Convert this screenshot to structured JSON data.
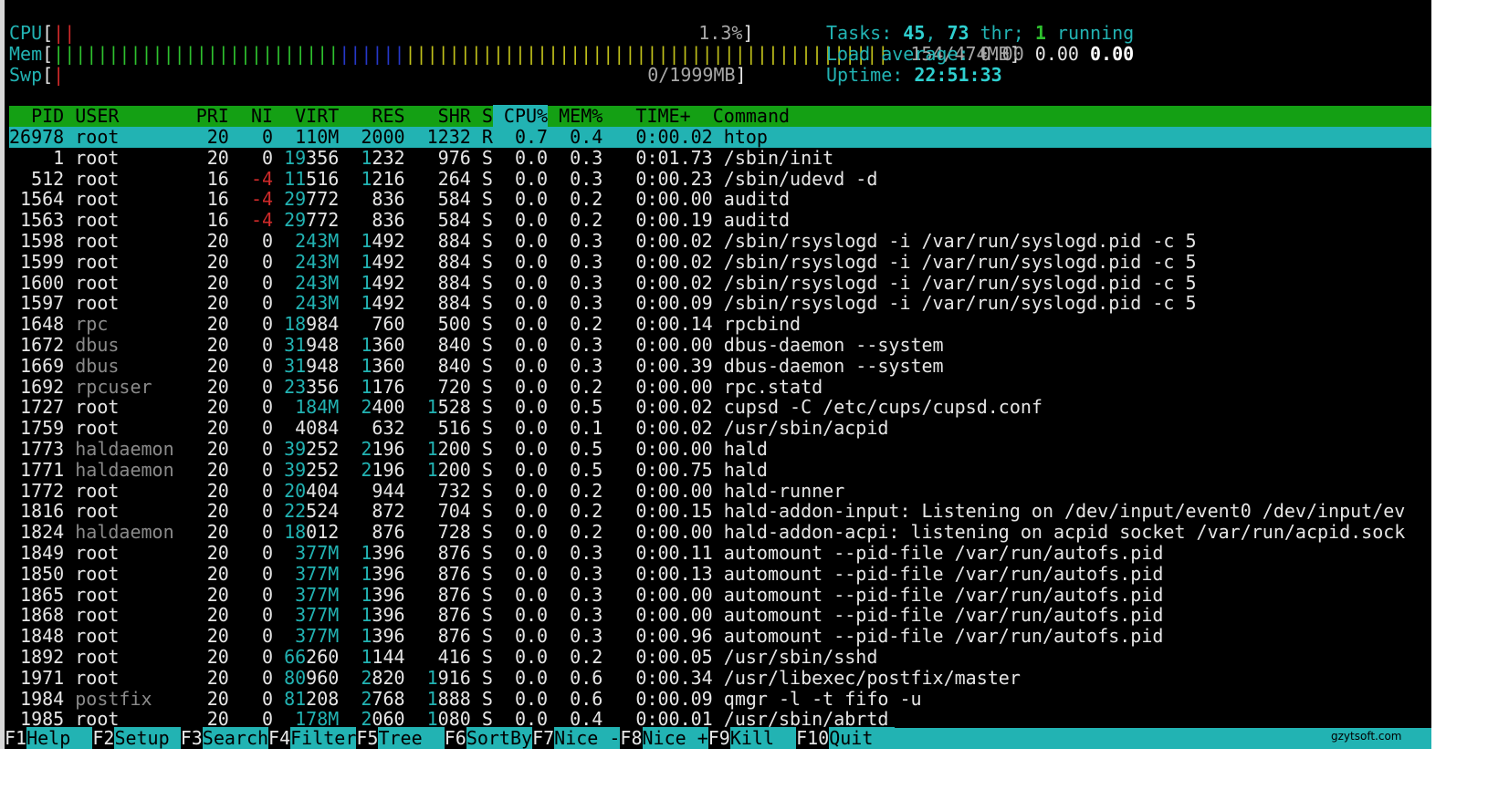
{
  "meters": {
    "cpu": {
      "label": "CPU",
      "value_text": "1.3%",
      "bar": "||"
    },
    "mem": {
      "label": "Mem",
      "value_text": "154/474MB",
      "bar_green": "||||||||||||||||||||||||||",
      "bar_blue": "||||||",
      "bar_yellow": "||||||||||||||||||||||||||||||||||||||||||||"
    },
    "swp": {
      "label": "Swp",
      "value_text": "0/1999MB",
      "bar": "|"
    }
  },
  "summary": {
    "tasks_label": "Tasks: ",
    "tasks": "45",
    "tasks_sep": ", ",
    "threads": "73",
    "thr_label": " thr; ",
    "running": "1",
    "running_label": " running",
    "load_label": "Load average: ",
    "load1": "0.00",
    "load5": "0.00",
    "load15": "0.00",
    "uptime_label": "Uptime: ",
    "uptime": "22:51:33"
  },
  "header": {
    "pid": "  PID",
    "user": " USER     ",
    "pri": "  PRI",
    "ni": "  NI",
    "virt": "  VIRT",
    "res": "   RES",
    "shr": "   SHR",
    "s": " S",
    "cpu": " CPU%",
    "mem": " MEM%",
    "time": "   TIME+  ",
    "cmd": "Command"
  },
  "processes": [
    {
      "pid": "26978",
      "user": "root",
      "pri": "20",
      "ni": "0",
      "virt": "110M",
      "res": "2000",
      "shr": "1232",
      "s": "R",
      "cpu": "0.7",
      "mem": "0.4",
      "time": "0:00.02",
      "cmd": "htop"
    },
    {
      "pid": "1",
      "user": "root",
      "pri": "20",
      "ni": "0",
      "virt": "19356",
      "res": "1232",
      "shr": "976",
      "s": "S",
      "cpu": "0.0",
      "mem": "0.3",
      "time": "0:01.73",
      "cmd": "/sbin/init"
    },
    {
      "pid": "512",
      "user": "root",
      "pri": "16",
      "ni": "-4",
      "virt": "11516",
      "res": "1216",
      "shr": "264",
      "s": "S",
      "cpu": "0.0",
      "mem": "0.3",
      "time": "0:00.23",
      "cmd": "/sbin/udevd -d"
    },
    {
      "pid": "1564",
      "user": "root",
      "pri": "16",
      "ni": "-4",
      "virt": "29772",
      "res": "836",
      "shr": "584",
      "s": "S",
      "cpu": "0.0",
      "mem": "0.2",
      "time": "0:00.00",
      "cmd": "auditd"
    },
    {
      "pid": "1563",
      "user": "root",
      "pri": "16",
      "ni": "-4",
      "virt": "29772",
      "res": "836",
      "shr": "584",
      "s": "S",
      "cpu": "0.0",
      "mem": "0.2",
      "time": "0:00.19",
      "cmd": "auditd"
    },
    {
      "pid": "1598",
      "user": "root",
      "pri": "20",
      "ni": "0",
      "virt": "243M",
      "res": "1492",
      "shr": "884",
      "s": "S",
      "cpu": "0.0",
      "mem": "0.3",
      "time": "0:00.02",
      "cmd": "/sbin/rsyslogd -i /var/run/syslogd.pid -c 5"
    },
    {
      "pid": "1599",
      "user": "root",
      "pri": "20",
      "ni": "0",
      "virt": "243M",
      "res": "1492",
      "shr": "884",
      "s": "S",
      "cpu": "0.0",
      "mem": "0.3",
      "time": "0:00.02",
      "cmd": "/sbin/rsyslogd -i /var/run/syslogd.pid -c 5"
    },
    {
      "pid": "1600",
      "user": "root",
      "pri": "20",
      "ni": "0",
      "virt": "243M",
      "res": "1492",
      "shr": "884",
      "s": "S",
      "cpu": "0.0",
      "mem": "0.3",
      "time": "0:00.02",
      "cmd": "/sbin/rsyslogd -i /var/run/syslogd.pid -c 5"
    },
    {
      "pid": "1597",
      "user": "root",
      "pri": "20",
      "ni": "0",
      "virt": "243M",
      "res": "1492",
      "shr": "884",
      "s": "S",
      "cpu": "0.0",
      "mem": "0.3",
      "time": "0:00.09",
      "cmd": "/sbin/rsyslogd -i /var/run/syslogd.pid -c 5"
    },
    {
      "pid": "1648",
      "user": "rpc",
      "pri": "20",
      "ni": "0",
      "virt": "18984",
      "res": "760",
      "shr": "500",
      "s": "S",
      "cpu": "0.0",
      "mem": "0.2",
      "time": "0:00.14",
      "cmd": "rpcbind"
    },
    {
      "pid": "1672",
      "user": "dbus",
      "pri": "20",
      "ni": "0",
      "virt": "31948",
      "res": "1360",
      "shr": "840",
      "s": "S",
      "cpu": "0.0",
      "mem": "0.3",
      "time": "0:00.00",
      "cmd": "dbus-daemon --system"
    },
    {
      "pid": "1669",
      "user": "dbus",
      "pri": "20",
      "ni": "0",
      "virt": "31948",
      "res": "1360",
      "shr": "840",
      "s": "S",
      "cpu": "0.0",
      "mem": "0.3",
      "time": "0:00.39",
      "cmd": "dbus-daemon --system"
    },
    {
      "pid": "1692",
      "user": "rpcuser",
      "pri": "20",
      "ni": "0",
      "virt": "23356",
      "res": "1176",
      "shr": "720",
      "s": "S",
      "cpu": "0.0",
      "mem": "0.2",
      "time": "0:00.00",
      "cmd": "rpc.statd"
    },
    {
      "pid": "1727",
      "user": "root",
      "pri": "20",
      "ni": "0",
      "virt": "184M",
      "res": "2400",
      "shr": "1528",
      "s": "S",
      "cpu": "0.0",
      "mem": "0.5",
      "time": "0:00.02",
      "cmd": "cupsd -C /etc/cups/cupsd.conf"
    },
    {
      "pid": "1759",
      "user": "root",
      "pri": "20",
      "ni": "0",
      "virt": "4084",
      "res": "632",
      "shr": "516",
      "s": "S",
      "cpu": "0.0",
      "mem": "0.1",
      "time": "0:00.02",
      "cmd": "/usr/sbin/acpid"
    },
    {
      "pid": "1773",
      "user": "haldaemon",
      "pri": "20",
      "ni": "0",
      "virt": "39252",
      "res": "2196",
      "shr": "1200",
      "s": "S",
      "cpu": "0.0",
      "mem": "0.5",
      "time": "0:00.00",
      "cmd": "hald"
    },
    {
      "pid": "1771",
      "user": "haldaemon",
      "pri": "20",
      "ni": "0",
      "virt": "39252",
      "res": "2196",
      "shr": "1200",
      "s": "S",
      "cpu": "0.0",
      "mem": "0.5",
      "time": "0:00.75",
      "cmd": "hald"
    },
    {
      "pid": "1772",
      "user": "root",
      "pri": "20",
      "ni": "0",
      "virt": "20404",
      "res": "944",
      "shr": "732",
      "s": "S",
      "cpu": "0.0",
      "mem": "0.2",
      "time": "0:00.00",
      "cmd": "hald-runner"
    },
    {
      "pid": "1816",
      "user": "root",
      "pri": "20",
      "ni": "0",
      "virt": "22524",
      "res": "872",
      "shr": "704",
      "s": "S",
      "cpu": "0.0",
      "mem": "0.2",
      "time": "0:00.15",
      "cmd": "hald-addon-input: Listening on /dev/input/event0 /dev/input/ev"
    },
    {
      "pid": "1824",
      "user": "haldaemon",
      "pri": "20",
      "ni": "0",
      "virt": "18012",
      "res": "876",
      "shr": "728",
      "s": "S",
      "cpu": "0.0",
      "mem": "0.2",
      "time": "0:00.00",
      "cmd": "hald-addon-acpi: listening on acpid socket /var/run/acpid.sock"
    },
    {
      "pid": "1849",
      "user": "root",
      "pri": "20",
      "ni": "0",
      "virt": "377M",
      "res": "1396",
      "shr": "876",
      "s": "S",
      "cpu": "0.0",
      "mem": "0.3",
      "time": "0:00.11",
      "cmd": "automount --pid-file /var/run/autofs.pid"
    },
    {
      "pid": "1850",
      "user": "root",
      "pri": "20",
      "ni": "0",
      "virt": "377M",
      "res": "1396",
      "shr": "876",
      "s": "S",
      "cpu": "0.0",
      "mem": "0.3",
      "time": "0:00.13",
      "cmd": "automount --pid-file /var/run/autofs.pid"
    },
    {
      "pid": "1865",
      "user": "root",
      "pri": "20",
      "ni": "0",
      "virt": "377M",
      "res": "1396",
      "shr": "876",
      "s": "S",
      "cpu": "0.0",
      "mem": "0.3",
      "time": "0:00.00",
      "cmd": "automount --pid-file /var/run/autofs.pid"
    },
    {
      "pid": "1868",
      "user": "root",
      "pri": "20",
      "ni": "0",
      "virt": "377M",
      "res": "1396",
      "shr": "876",
      "s": "S",
      "cpu": "0.0",
      "mem": "0.3",
      "time": "0:00.00",
      "cmd": "automount --pid-file /var/run/autofs.pid"
    },
    {
      "pid": "1848",
      "user": "root",
      "pri": "20",
      "ni": "0",
      "virt": "377M",
      "res": "1396",
      "shr": "876",
      "s": "S",
      "cpu": "0.0",
      "mem": "0.3",
      "time": "0:00.96",
      "cmd": "automount --pid-file /var/run/autofs.pid"
    },
    {
      "pid": "1892",
      "user": "root",
      "pri": "20",
      "ni": "0",
      "virt": "66260",
      "res": "1144",
      "shr": "416",
      "s": "S",
      "cpu": "0.0",
      "mem": "0.2",
      "time": "0:00.05",
      "cmd": "/usr/sbin/sshd"
    },
    {
      "pid": "1971",
      "user": "root",
      "pri": "20",
      "ni": "0",
      "virt": "80960",
      "res": "2820",
      "shr": "1916",
      "s": "S",
      "cpu": "0.0",
      "mem": "0.6",
      "time": "0:00.34",
      "cmd": "/usr/libexec/postfix/master"
    },
    {
      "pid": "1984",
      "user": "postfix",
      "pri": "20",
      "ni": "0",
      "virt": "81208",
      "res": "2768",
      "shr": "1888",
      "s": "S",
      "cpu": "0.0",
      "mem": "0.6",
      "time": "0:00.09",
      "cmd": "qmgr -l -t fifo -u"
    },
    {
      "pid": "1985",
      "user": "root",
      "pri": "20",
      "ni": "0",
      "virt": "178M",
      "res": "2060",
      "shr": "1080",
      "s": "S",
      "cpu": "0.0",
      "mem": "0.4",
      "time": "0:00.01",
      "cmd": "/usr/sbin/abrtd"
    }
  ],
  "fkeys": [
    {
      "key": "F1",
      "label": "Help  "
    },
    {
      "key": "F2",
      "label": "Setup "
    },
    {
      "key": "F3",
      "label": "Search"
    },
    {
      "key": "F4",
      "label": "Filter"
    },
    {
      "key": "F5",
      "label": "Tree  "
    },
    {
      "key": "F6",
      "label": "SortBy"
    },
    {
      "key": "F7",
      "label": "Nice -"
    },
    {
      "key": "F8",
      "label": "Nice +"
    },
    {
      "key": "F9",
      "label": "Kill  "
    },
    {
      "key": "F10",
      "label": "Quit  "
    }
  ],
  "watermark": "gzytsoft.com",
  "colors": {
    "background": "#000000",
    "header_bg": "#14a014",
    "selection_bg": "#22b3b3",
    "accent_cyan": "#22b3b3",
    "meter_green": "#2ec02e",
    "meter_blue": "#2638c8",
    "meter_yellow": "#bfbf1a",
    "nice_red": "#cf2a2a"
  }
}
